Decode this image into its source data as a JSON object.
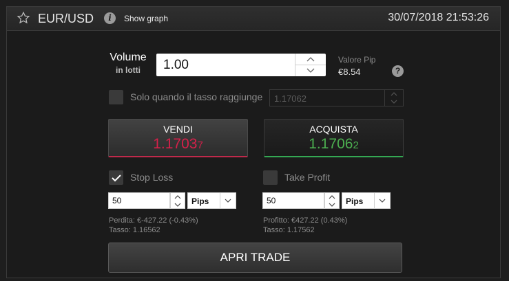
{
  "header": {
    "pair": "EUR/USD",
    "show_graph": "Show graph",
    "datetime": "30/07/2018 21:53:26"
  },
  "volume": {
    "label": "Volume",
    "sublabel": "in lotti",
    "value": "1.00"
  },
  "pip": {
    "label": "Valore Pip",
    "value": "€8.54"
  },
  "limit_order": {
    "label": "Solo quando il tasso raggiunge",
    "value": "1.17062",
    "checked": false
  },
  "sell": {
    "label": "VENDI",
    "price_main": "1.1703",
    "price_last": "7",
    "color": "#d6204a"
  },
  "buy": {
    "label": "ACQUISTA",
    "price_main": "1.1706",
    "price_last": "2",
    "color": "#4caf50"
  },
  "stop_loss": {
    "label": "Stop Loss",
    "checked": true,
    "value": "50",
    "unit": "Pips",
    "loss": "Perdita: €-427.22 (-0.43%)",
    "rate": "Tasso: 1.16562"
  },
  "take_profit": {
    "label": "Take Profit",
    "checked": false,
    "value": "50",
    "unit": "Pips",
    "profit": "Profitto: €427.22 (0.43%)",
    "rate": "Tasso: 1.17562"
  },
  "submit": {
    "label": "APRI TRADE"
  }
}
